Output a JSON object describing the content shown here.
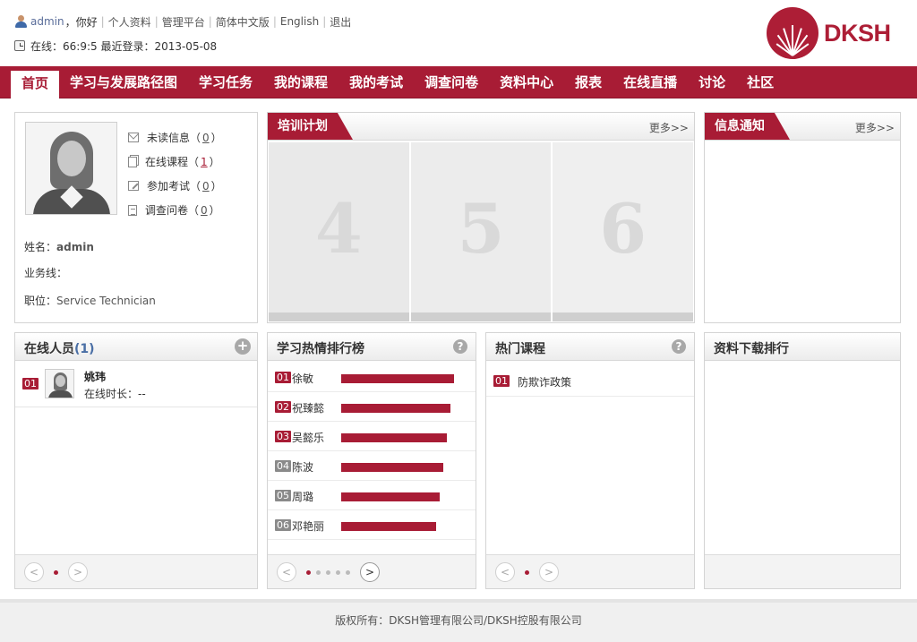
{
  "header": {
    "username": "admin",
    "greeting": "，你好",
    "links": [
      "个人资料",
      "管理平台",
      "简体中文版",
      "English",
      "退出"
    ],
    "online_text": "在线：66:9:5 最近登录：2013-05-08",
    "logo_text": "DKSH"
  },
  "nav": {
    "items": [
      "首页",
      "学习与发展路径图",
      "学习任务",
      "我的课程",
      "我的考试",
      "调查问卷",
      "资料中心",
      "报表",
      "在线直播",
      "讨论",
      "社区"
    ],
    "active_index": 0
  },
  "profile": {
    "stats": [
      {
        "label": "未读信息（",
        "value": "0",
        "close": "）"
      },
      {
        "label": "在线课程（",
        "value": "1",
        "close": "）"
      },
      {
        "label": "参加考试（",
        "value": "0",
        "close": "）"
      },
      {
        "label": "调查问卷（",
        "value": "0",
        "close": "）"
      }
    ],
    "name_label": "姓名：",
    "name_value": "admin",
    "line_label": "业务线：",
    "line_value": "",
    "position_label": "职位：",
    "position_value": "Service Technician"
  },
  "training": {
    "title": "培训计划",
    "more": "更多>>",
    "slides": [
      "4",
      "5",
      "6"
    ]
  },
  "notice": {
    "title": "信息通知",
    "more": "更多>>"
  },
  "online_users": {
    "title": "在线人员",
    "count": "(1)",
    "items": [
      {
        "rank": "01",
        "name": "姚玮",
        "time": "在线时长：--"
      }
    ]
  },
  "ranking": {
    "title": "学习热情排行榜",
    "items": [
      {
        "rank": "01",
        "name": "徐敏",
        "score": 1.0
      },
      {
        "rank": "02",
        "name": "祝臻懿",
        "score": 0.968
      },
      {
        "rank": "03",
        "name": "吴懿乐",
        "score": 0.936
      },
      {
        "rank": "04",
        "name": "陈波",
        "score": 0.905
      },
      {
        "rank": "05",
        "name": "周璐",
        "score": 0.873
      },
      {
        "rank": "06",
        "name": "邓艳丽",
        "score": 0.841
      }
    ]
  },
  "hot_courses": {
    "title": "热门课程",
    "items": [
      {
        "rank": "01",
        "name": "防欺诈政策"
      }
    ]
  },
  "downloads": {
    "title": "资料下载排行"
  },
  "pager": {
    "prev": "<",
    "next": ">"
  },
  "footer": {
    "text": "版权所有：DKSH管理有限公司/DKSH控股有限公司"
  },
  "colors": {
    "brand": "#a81c35"
  }
}
